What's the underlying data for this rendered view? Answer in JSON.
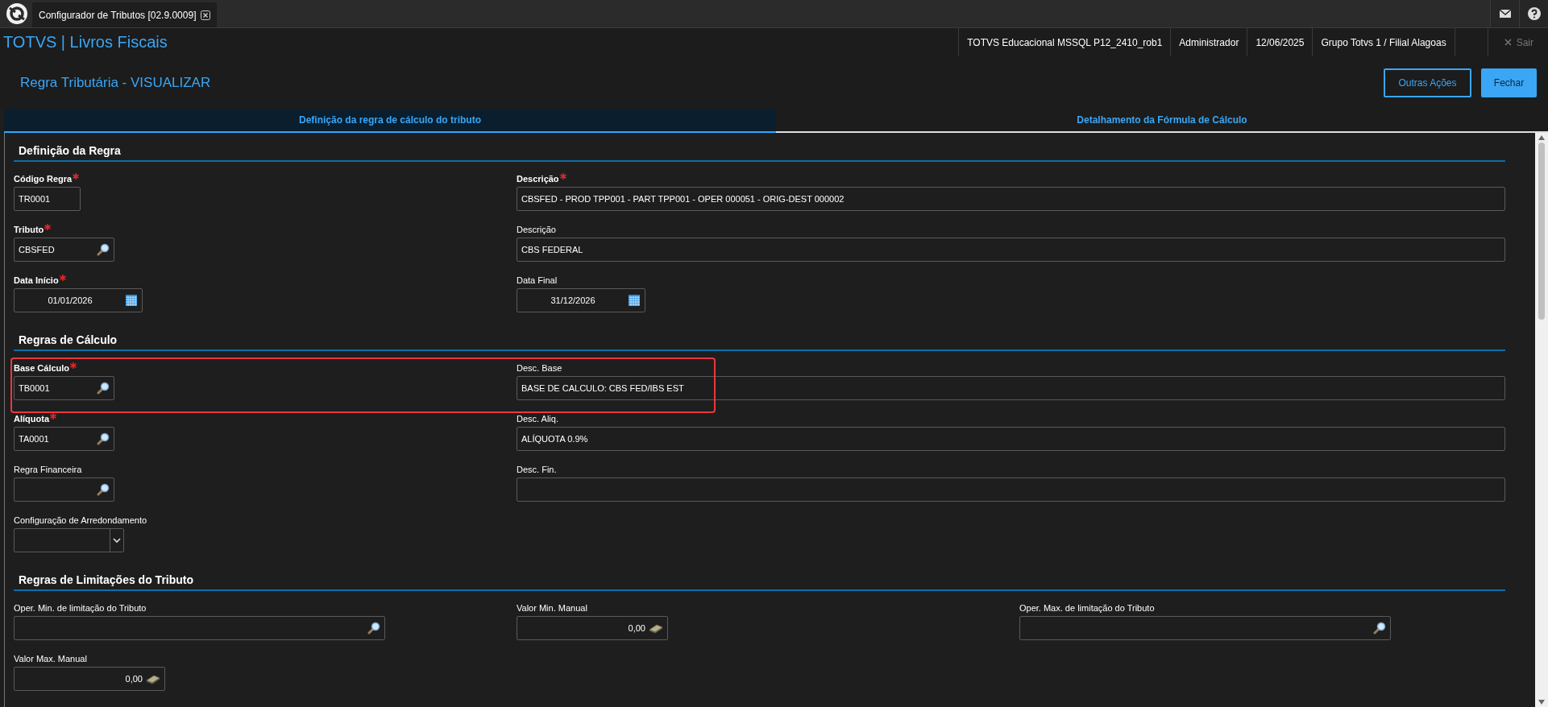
{
  "app_tab": {
    "title": "Configurador de Tributos [02.9.0009]"
  },
  "header": {
    "brand": "TOTVS | Livros Fiscais",
    "info": [
      "TOTVS Educacional MSSQL P12_2410_rob1",
      "Administrador",
      "12/06/2025",
      "Grupo Totvs 1 / Filial Alagoas"
    ],
    "logout": "Sair"
  },
  "page": {
    "title": "Regra Tributária - VISUALIZAR",
    "actions": [
      {
        "label": "Outras Ações",
        "kind": "outline"
      },
      {
        "label": "Fechar",
        "kind": "primary"
      }
    ]
  },
  "tabs": [
    {
      "label": "Definição da regra de cálculo do tributo",
      "selected": true
    },
    {
      "label": "Detalhamento da Fórmula de Cálculo",
      "selected": false
    }
  ],
  "sections": [
    {
      "title": "Definição da Regra",
      "rows": [
        {
          "highlighted": false,
          "fields": [
            {
              "label": "Código Regra",
              "required": true,
              "kind": "code",
              "value": "TR0001"
            },
            {
              "label": "Descrição",
              "required": true,
              "kind": "text",
              "value": "CBSFED - PROD TPP001 - PART TPP001 - OPER 000051 - ORIG-DEST 000002"
            }
          ]
        },
        {
          "highlighted": false,
          "fields": [
            {
              "label": "Tributo",
              "required": true,
              "kind": "lookup",
              "value": "CBSFED"
            },
            {
              "label": "Descrição",
              "required": false,
              "kind": "text",
              "value": "CBS FEDERAL"
            }
          ]
        },
        {
          "highlighted": false,
          "fields": [
            {
              "label": "Data Início",
              "required": true,
              "kind": "date",
              "value": "01/01/2026"
            },
            {
              "label": "Data Final",
              "required": false,
              "kind": "date",
              "value": "31/12/2026"
            }
          ]
        }
      ]
    },
    {
      "title": "Regras de Cálculo",
      "rows": [
        {
          "highlighted": true,
          "fields": [
            {
              "label": "Base Cálculo",
              "required": true,
              "kind": "lookup",
              "value": "TB0001"
            },
            {
              "label": "Desc. Base",
              "required": false,
              "kind": "text",
              "value": "BASE DE CALCULO: CBS FED/IBS EST"
            }
          ]
        },
        {
          "highlighted": false,
          "fields": [
            {
              "label": "Alíquota",
              "required": true,
              "kind": "lookup",
              "value": "TA0001"
            },
            {
              "label": "Desc. Aliq.",
              "required": false,
              "kind": "text",
              "value": "ALÍQUOTA 0.9%"
            }
          ]
        },
        {
          "highlighted": false,
          "fields": [
            {
              "label": "Regra Financeira",
              "required": false,
              "kind": "lookup"
            },
            {
              "label": "Desc. Fin.",
              "required": false,
              "kind": "text"
            }
          ]
        },
        {
          "highlighted": false,
          "fields": [
            {
              "label": "Configuração de Arredondamento",
              "required": false,
              "kind": "select"
            }
          ]
        }
      ]
    },
    {
      "title": "Regras de Limitações do Tributo",
      "rows": [
        {
          "highlighted": false,
          "fields": [
            {
              "label": "Oper. Min. de limitação do Tributo",
              "required": false,
              "kind": "lookup-wide"
            },
            {
              "label": "Valor Min. Manual",
              "required": false,
              "kind": "money",
              "value": "0,00"
            },
            {
              "label": "Oper. Max. de limitação do Tributo",
              "required": false,
              "kind": "lookup-wide"
            }
          ]
        },
        {
          "highlighted": false,
          "fields": [
            {
              "label": "Valor Max. Manual",
              "required": false,
              "kind": "money",
              "value": "0,00"
            }
          ]
        }
      ]
    }
  ]
}
